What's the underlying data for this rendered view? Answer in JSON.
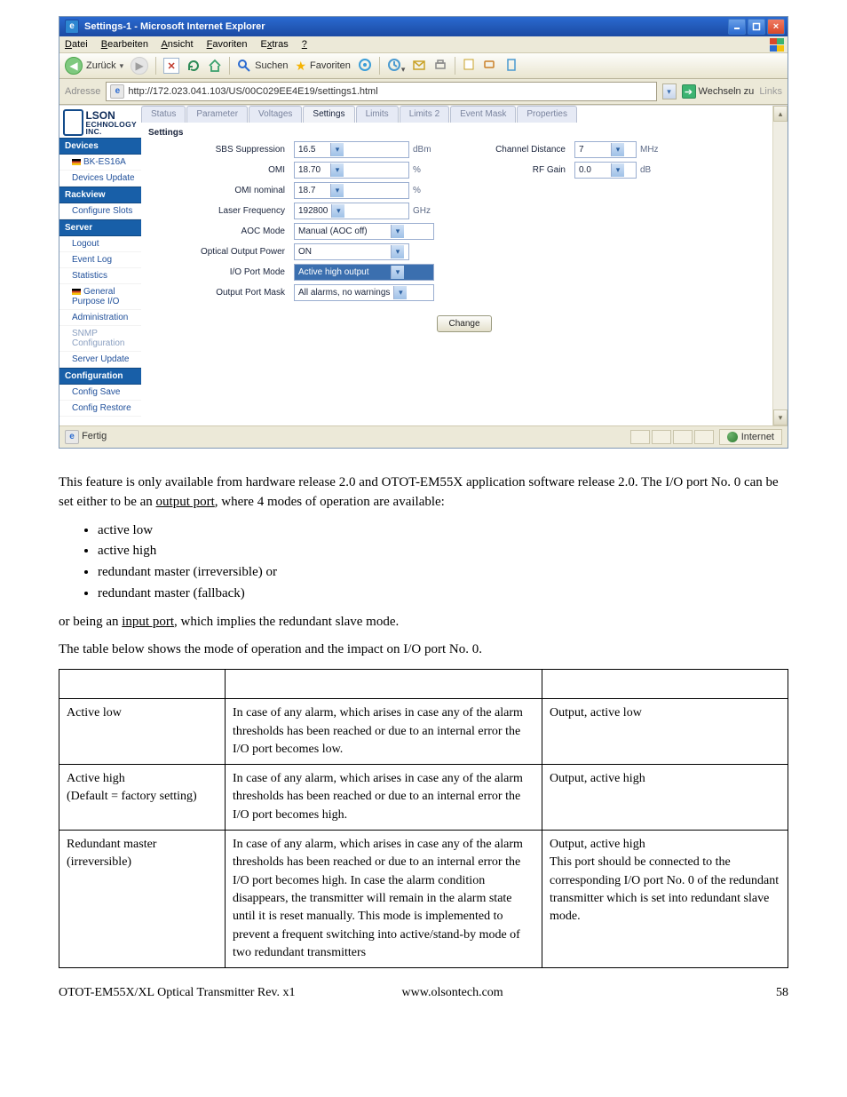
{
  "screenshot": {
    "title": "Settings-1 - Microsoft Internet Explorer",
    "menubar": [
      "Datei",
      "Bearbeiten",
      "Ansicht",
      "Favoriten",
      "Extras",
      "?"
    ],
    "toolbar": {
      "back": "Zurück",
      "search": "Suchen",
      "favorites": "Favoriten"
    },
    "addressbar": {
      "label": "Adresse",
      "url": "http://172.023.041.103/US/00C029EE4E19/settings1.html",
      "go": "Wechseln zu",
      "links": "Links"
    },
    "sidebar": {
      "logo1": "LSON",
      "logo2": "ECHNOLOGY INC.",
      "sections": [
        {
          "header": "Devices",
          "items": [
            "BK-ES16A",
            "Devices Update"
          ]
        },
        {
          "header": "Rackview",
          "items": [
            "Configure Slots"
          ]
        },
        {
          "header": "Server",
          "items": [
            "Logout",
            "Event Log",
            "Statistics",
            "General Purpose I/O",
            "Administration",
            "SNMP Configuration",
            "Server Update"
          ]
        },
        {
          "header": "Configuration",
          "items": [
            "Config Save",
            "Config Restore"
          ]
        }
      ]
    },
    "tabs": [
      "Status",
      "Parameter",
      "Voltages",
      "Settings",
      "Limits",
      "Limits 2",
      "Event Mask",
      "Properties"
    ],
    "active_tab_index": 3,
    "section_label": "Settings",
    "form_rows": [
      {
        "label": "SBS Suppression",
        "value": "16.5",
        "unit": "dBm",
        "label2": "Channel Distance",
        "value2": "7",
        "unit2": "MHz"
      },
      {
        "label": "OMI",
        "value": "18.70",
        "unit": "%",
        "label2": "RF Gain",
        "value2": "0.0",
        "unit2": "dB"
      },
      {
        "label": "OMI nominal",
        "value": "18.7",
        "unit": "%"
      },
      {
        "label": "Laser Frequency",
        "value": "192800",
        "unit": "GHz"
      },
      {
        "label": "AOC Mode",
        "value": "Manual (AOC off)",
        "long": true
      },
      {
        "label": "Optical Output Power",
        "value": "ON",
        "long": true
      },
      {
        "label": "I/O Port Mode",
        "value": "Active high output",
        "long": true,
        "blue": true
      },
      {
        "label": "Output Port Mask",
        "value": "All alarms, no warnings",
        "long": true
      }
    ],
    "change_button": "Change",
    "statusbar": {
      "left": "Fertig",
      "right": "Internet"
    }
  },
  "doc": {
    "p1a": "This feature is only available from hardware release 2.0 and OTOT-EM55X application software release 2.0. The I/O port No. 0 can be set either to be an ",
    "p1_u": "output port",
    "p1b": ", where 4 modes of operation are available:",
    "modes": [
      "active low",
      "active high",
      "redundant master (irreversible) or",
      "redundant master (fallback)"
    ],
    "p2a": "or being an ",
    "p2_u": "input port",
    "p2b": ", which implies the redundant slave mode.",
    "p3": "The table below shows the mode of operation and the impact on I/O port No. 0.",
    "table": [
      {
        "c1": "Active low",
        "c2": "In case of any alarm, which arises in case any of the alarm thresholds has been reached or due to an internal error the I/O port becomes low.",
        "c3": "Output, active low"
      },
      {
        "c1": "Active high\n(Default = factory setting)",
        "c2": "In case of any alarm, which arises in case any of the alarm thresholds has been reached or due to an internal error the I/O port becomes high.",
        "c3": "Output, active high"
      },
      {
        "c1": "Redundant master (irreversible)",
        "c2": "In case of any alarm, which arises in case any of the alarm thresholds has been reached or due to an internal error the I/O port becomes high. In case the alarm condition disappears, the transmitter will remain in the alarm state until it is reset manually. This mode is implemented to prevent a frequent switching into active/stand-by mode of two redundant transmitters",
        "c3": "Output, active high\nThis port should be connected to the corresponding I/O port No. 0 of the redundant transmitter which is set into    redundant slave mode."
      }
    ],
    "footer": {
      "left": "OTOT-EM55X/XL Optical Transmitter Rev. x1",
      "mid": "www.olsontech.com",
      "page": "58"
    }
  }
}
